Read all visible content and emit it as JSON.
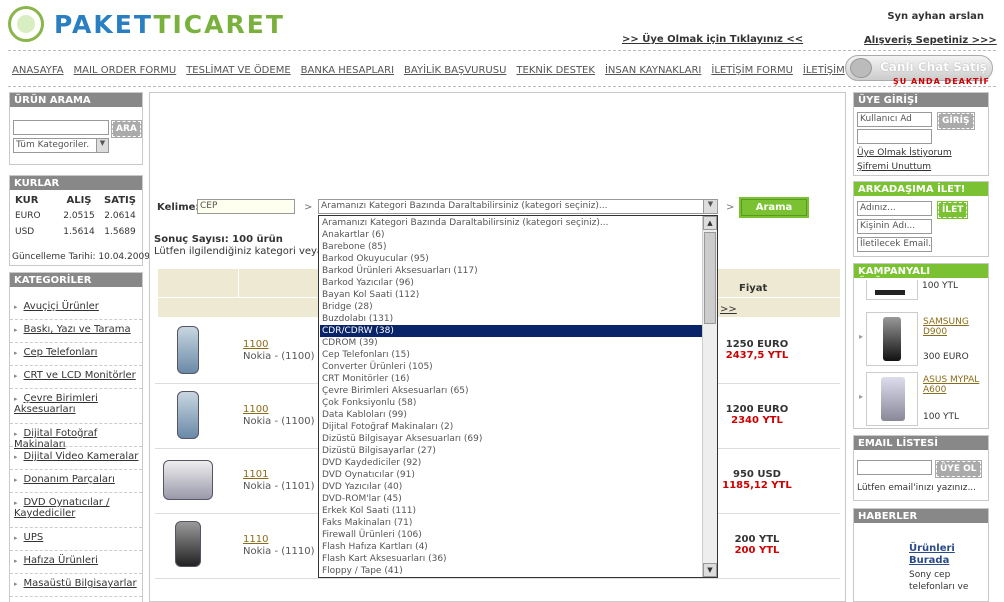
{
  "header": {
    "logo_a": "PAKET",
    "logo_b": "TICARET",
    "user": "Syn ayhan arslan",
    "member_link": ">> Üye Olmak için Tıklayınız <<",
    "cart_link": "Alışveriş Sepetiniz >>>"
  },
  "nav": [
    "ANASAYFA",
    "MAIL ORDER FORMU",
    "TESLİMAT VE ÖDEME",
    "BANKA HESAPLARI",
    "BAYİLİK BAŞVURUSU",
    "TEKNİK DESTEK",
    "İNSAN KAYNAKLARI",
    "İLETİŞİM FORMU",
    "İLETİŞİM"
  ],
  "chat": {
    "label": "Canlı Chat Satış",
    "status": "ŞU ANDA DEAKTİF"
  },
  "search_panel": {
    "title": "ÜRÜN ARAMA",
    "button": "ARA",
    "category": "Tüm Kategoriler."
  },
  "rates": {
    "title": "KURLAR",
    "headers": [
      "KUR",
      "ALIŞ",
      "SATIŞ"
    ],
    "rows": [
      [
        "EURO",
        "2.0515",
        "2.0614"
      ],
      [
        "USD",
        "1.5614",
        "1.5689"
      ]
    ],
    "updated": "Güncelleme Tarihi: 10.04.2009"
  },
  "categories": {
    "title": "KATEGORİLER",
    "items": [
      "Avuçiçi Ürünler",
      "Baskı, Yazı ve Tarama",
      "Cep Telefonları",
      "CRT ve LCD Monitörler",
      "Çevre Birimleri Aksesuarları",
      "Dijital Fotoğraf Makinaları",
      "Dijital Video Kameralar",
      "Donanım Parçaları",
      "DVD Oynatıcılar / Kaydediciler",
      "UPS",
      "Hafıza Ürünleri",
      "Masaüstü Bilgisayarlar"
    ]
  },
  "main": {
    "keyword_label": "Kelime:",
    "keyword": "CEP",
    "category_select": "Aramanızı Kategori Bazında Daraltabilirsiniz (kategori seçiniz)...",
    "search_button": "Arama",
    "result_count": "Sonuç Sayısı: 100 ürün",
    "result_hint": "Lütfen ilgilendiğiniz kategori veya ürü",
    "price_header": "Fiyat",
    "next": ">>"
  },
  "dropdown": [
    "Aramanızı Kategori Bazında Daraltabilirsiniz (kategori seçiniz)...",
    "Anakartlar (6)",
    "Barebone (85)",
    "Barkod Okuyucular (95)",
    "Barkod Ürünleri Aksesuarları (117)",
    "Barkod Yazıcılar (96)",
    "Bayan Kol Saati (112)",
    "Bridge (28)",
    "Buzdolabı (131)",
    "CDR/CDRW (38)",
    "CDROM (39)",
    "Cep Telefonları (15)",
    "Converter Ürünleri (105)",
    "CRT Monitörler (16)",
    "Çevre Birimleri Aksesuarları (65)",
    "Çok Fonksiyonlu (58)",
    "Data Kabloları (99)",
    "Dijital Fotoğraf Makinaları (2)",
    "Dizüstü Bilgisayar Aksesuarları (69)",
    "Dizüstü Bilgisayarlar (27)",
    "DVD Kaydediciler (92)",
    "DVD Oynatıcılar (91)",
    "DVD Yazıcılar (40)",
    "DVD-ROM'lar (45)",
    "Erkek Kol Saati (111)",
    "Faks Makinaları (71)",
    "Firewall Ürünleri (106)",
    "Flash Hafıza Kartları (4)",
    "Flash Kart Aksesuarları (36)",
    "Floppy / Tape (41)"
  ],
  "dropdown_selected": 9,
  "products": [
    {
      "code": "1100",
      "name": "Nokia - (1100)",
      "price": "1250 EURO",
      "ytl": "2437,5 YTL"
    },
    {
      "code": "1100",
      "name": "Nokia - (1100)",
      "price": "1200 EURO",
      "ytl": "2340 YTL"
    },
    {
      "code": "1101",
      "name": "Nokia - (1101)",
      "price": "950 USD",
      "ytl": "1185,12 YTL"
    },
    {
      "code": "1110",
      "name": "Nokia - (1110)",
      "price": "200 YTL",
      "ytl": "200 YTL"
    }
  ],
  "login": {
    "title": "ÜYE GİRİŞİ",
    "user_ph": "Kullanıcı Ad",
    "button": "GİRİŞ",
    "register": "Üye Olmak İstiyorum",
    "forgot": "Şifremi Unuttum"
  },
  "friend": {
    "title": "ARKADAŞIMA İLET!",
    "name": "Adınız...",
    "button": "İLET",
    "recipient": "Kişinin Adı...",
    "email": "İletilecek Email.."
  },
  "campaign": {
    "title": "KAMPANYALI ÜRÜNLER!",
    "top_price": "100 YTL",
    "items": [
      {
        "name": "SAMSUNG D900",
        "price": "300 EURO"
      },
      {
        "name": "ASUS MYPAL A600",
        "price": "100 YTL"
      }
    ]
  },
  "email_list": {
    "title": "EMAIL LİSTESİ",
    "button": "ÜYE OL",
    "note": "Lütfen email'inızı yazınız..."
  },
  "news": {
    "title": "HABERLER",
    "headline": "Ürünleri Burada",
    "body": "Sony cep telefonları ve"
  }
}
